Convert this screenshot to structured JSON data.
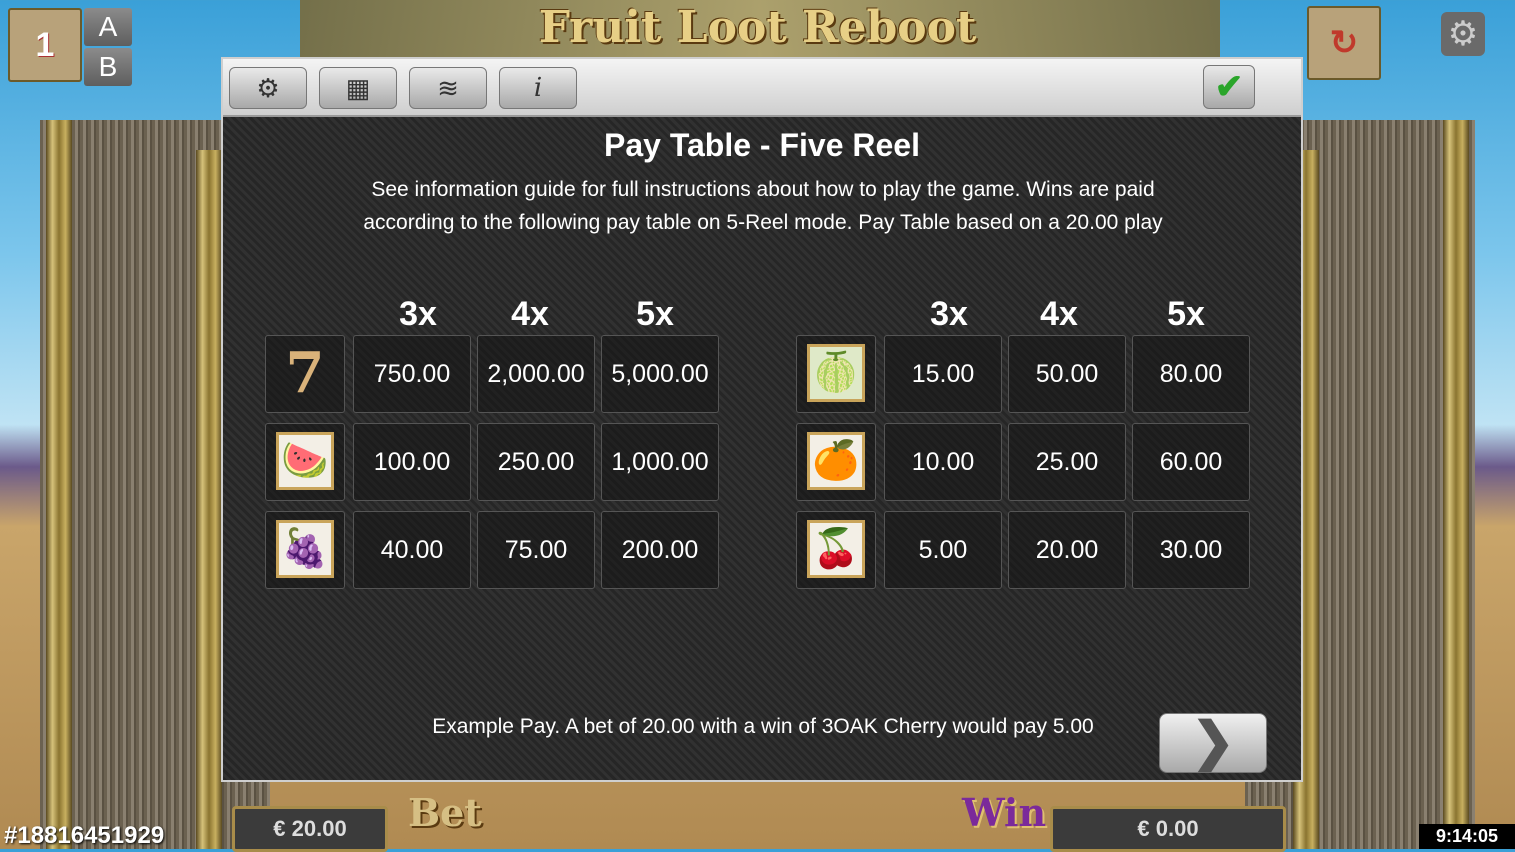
{
  "game": {
    "title": "Fruit Loot Reboot",
    "ab_top": "A",
    "ab_bottom": "B",
    "line_count": "1"
  },
  "dialog": {
    "title": "Pay Table - Five Reel",
    "description": "See information guide for full instructions about how to play the game. Wins are paid according to the following pay table on 5-Reel mode. Pay Table based on a 20.00 play",
    "toolbar": {
      "settings_icon": "gear-icon",
      "paytable_icon": "paytable-icon",
      "paylines_icon": "paylines-icon",
      "info_label": "i",
      "ok_icon": "checkmark-icon"
    },
    "left_headers": [
      "3x",
      "4x",
      "5x"
    ],
    "right_headers": [
      "3x",
      "4x",
      "5x"
    ],
    "left_rows": [
      {
        "symbol": "seven",
        "glyph": "7",
        "values": [
          "750.00",
          "2,000.00",
          "5,000.00"
        ]
      },
      {
        "symbol": "watermelon",
        "glyph": "🍉",
        "values": [
          "100.00",
          "250.00",
          "1,000.00"
        ]
      },
      {
        "symbol": "grapes",
        "glyph": "🍇",
        "values": [
          "40.00",
          "75.00",
          "200.00"
        ]
      }
    ],
    "right_rows": [
      {
        "symbol": "lime",
        "glyph": "🍈",
        "values": [
          "15.00",
          "50.00",
          "80.00"
        ]
      },
      {
        "symbol": "orange",
        "glyph": "🍊",
        "values": [
          "10.00",
          "25.00",
          "60.00"
        ]
      },
      {
        "symbol": "cherry",
        "glyph": "🍒",
        "values": [
          "5.00",
          "20.00",
          "30.00"
        ]
      }
    ],
    "example": "Example Pay. A bet of 20.00 with a win of 3OAK Cherry would pay 5.00",
    "next_label": "❯"
  },
  "footer": {
    "bet_label": "Bet",
    "bet_value": "€ 20.00",
    "win_label": "Win",
    "win_value": "€ 0.00",
    "ticket": "#18816451929",
    "clock": "9:14:05"
  }
}
